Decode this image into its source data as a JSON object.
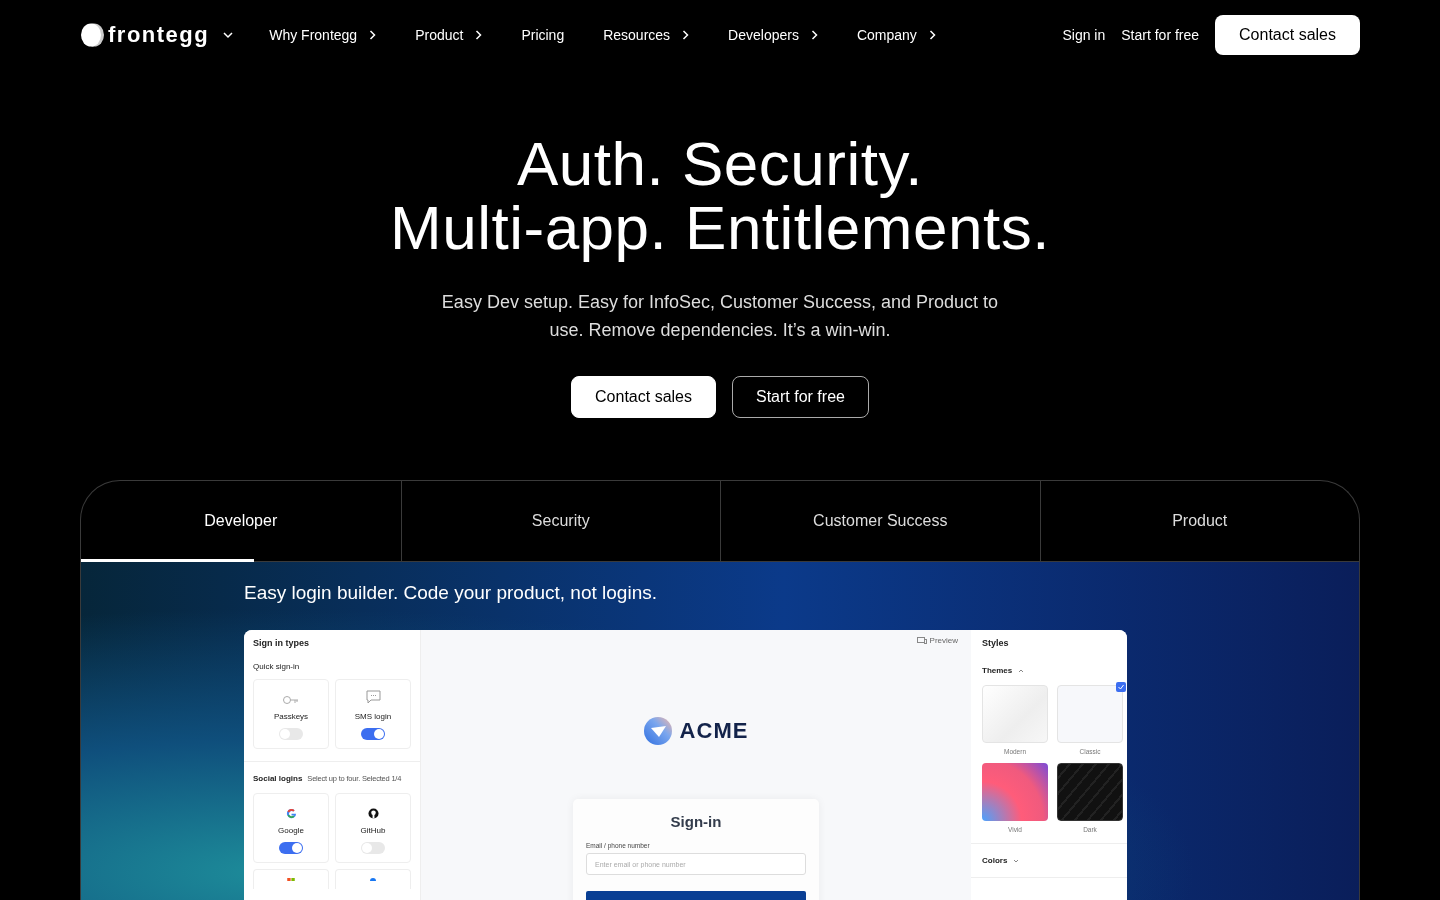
{
  "nav": {
    "logo": "frontegg",
    "items": [
      {
        "label": "Why Frontegg",
        "has_submenu": true
      },
      {
        "label": "Product",
        "has_submenu": true
      },
      {
        "label": "Pricing",
        "has_submenu": false
      },
      {
        "label": "Resources",
        "has_submenu": true
      },
      {
        "label": "Developers",
        "has_submenu": true
      },
      {
        "label": "Company",
        "has_submenu": true
      }
    ],
    "links": [
      "Sign in",
      "Start for free"
    ],
    "contact": "Contact sales"
  },
  "hero": {
    "title_lines": [
      "Auth. Security.",
      "Multi-app. Entitlements."
    ],
    "subtitle": "Easy Dev setup. Easy for InfoSec, Customer Success, and Product to use. Remove dependencies. It’s a win-win.",
    "buttons": [
      {
        "label": "Contact sales",
        "kind": "primary"
      },
      {
        "label": "Start for free",
        "kind": "outline"
      }
    ]
  },
  "tabs": [
    {
      "label": "Developer",
      "selected": true
    },
    {
      "label": "Security",
      "selected": false
    },
    {
      "label": "Customer Success",
      "selected": false
    },
    {
      "label": "Product",
      "selected": false
    }
  ],
  "demo": {
    "heading": "Easy login builder. Code your product, not logins.",
    "left": {
      "title": "Sign in types",
      "quick_title": "Quick sign-in",
      "quick": [
        {
          "label": "Passkeys",
          "kind": "key",
          "on": false
        },
        {
          "label": "SMS login",
          "kind": "chat",
          "on": true
        }
      ],
      "social_title": "Social logins",
      "social_hint": "Select up to four. Selected 1/4",
      "social": [
        {
          "label": "Google",
          "kind": "google",
          "on": true
        },
        {
          "label": "GitHub",
          "kind": "github",
          "on": false
        }
      ],
      "cut_cards": [
        {
          "kind": "microsoft"
        },
        {
          "kind": "facebook"
        }
      ]
    },
    "center": {
      "preview": "Preview",
      "brand": "ACME",
      "card_title": "Sign-in",
      "field_label": "Email / phone number",
      "placeholder": "Enter email or phone number"
    },
    "right": {
      "title": "Styles",
      "themes_title": "Themes",
      "themes": [
        {
          "label": "Modern",
          "kind": "modern",
          "selected": false
        },
        {
          "label": "Classic",
          "kind": "classic",
          "selected": true
        },
        {
          "label": "Vivid",
          "kind": "vivid",
          "selected": false
        },
        {
          "label": "Dark",
          "kind": "dark",
          "selected": false
        }
      ],
      "colors": "Colors"
    }
  }
}
